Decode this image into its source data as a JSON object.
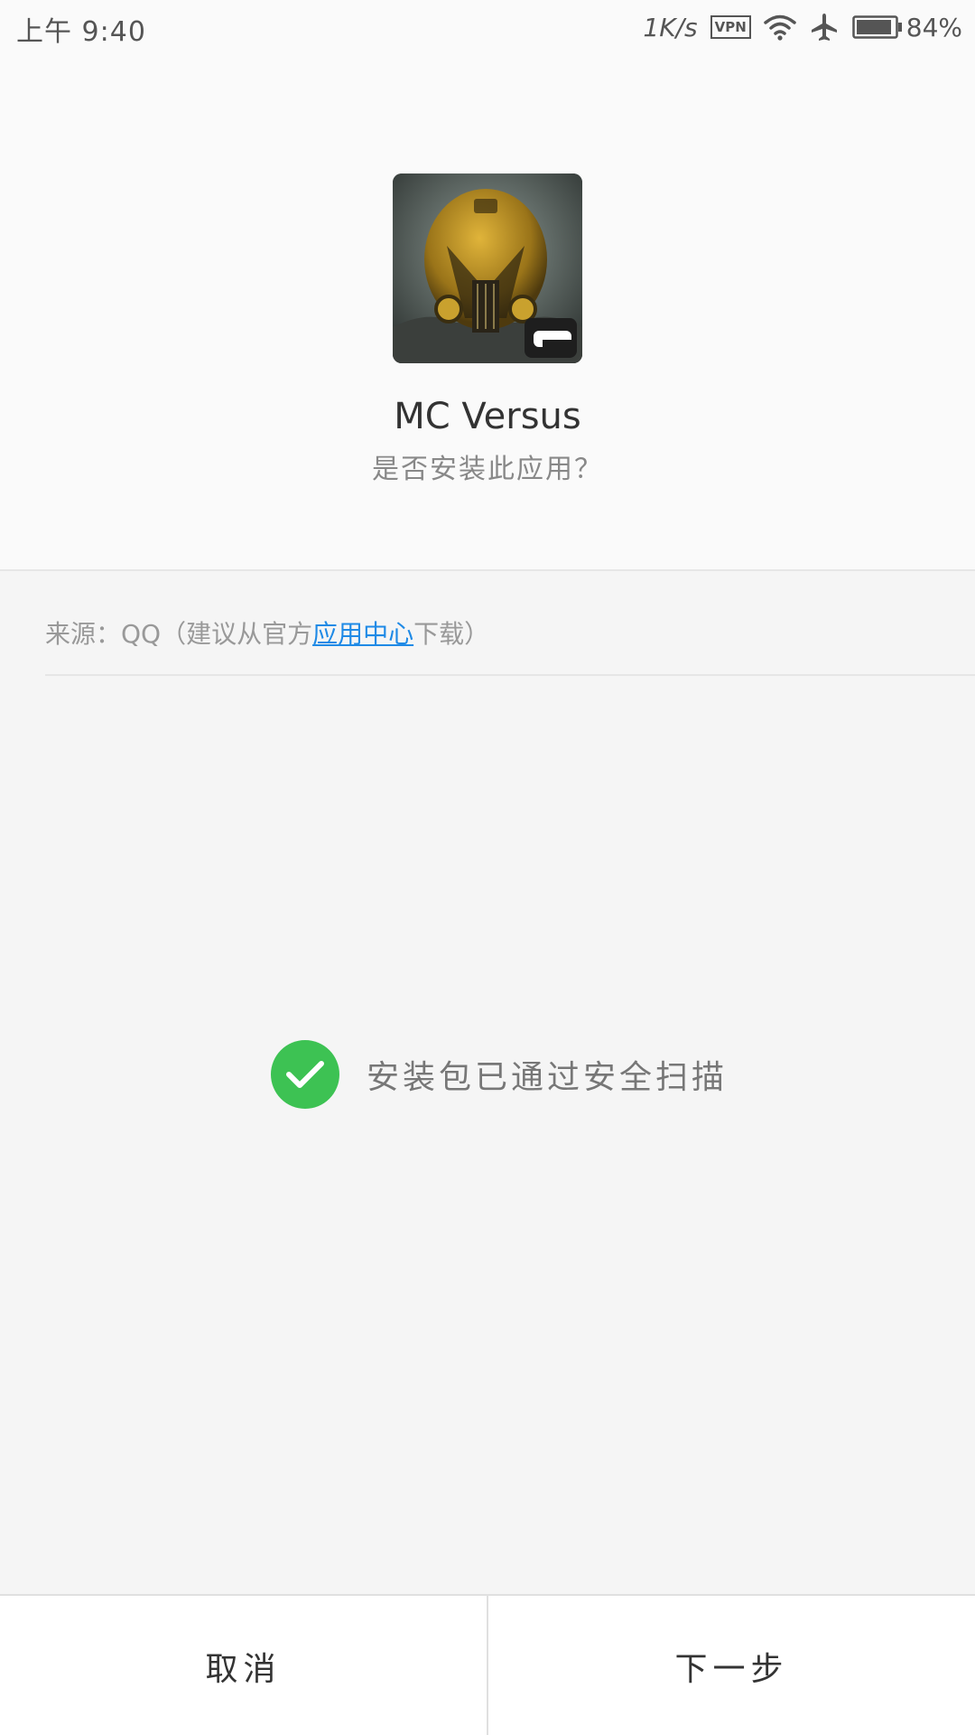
{
  "status_bar": {
    "time": "上午 9:40",
    "net_speed": "1K/s",
    "vpn": "VPN",
    "battery": "84%"
  },
  "app": {
    "name": "MC Versus",
    "question": "是否安装此应用？",
    "icon": "game-icon-helmet"
  },
  "source": {
    "prefix": "来源：QQ（建议从官方",
    "link": "应用中心",
    "suffix": "下载）"
  },
  "scan": {
    "text": "安装包已通过安全扫描",
    "color": "#3dc253"
  },
  "actions": {
    "cancel": "取消",
    "next": "下一步"
  },
  "colors": {
    "link": "#1f8ae6",
    "check": "#3dc253"
  }
}
